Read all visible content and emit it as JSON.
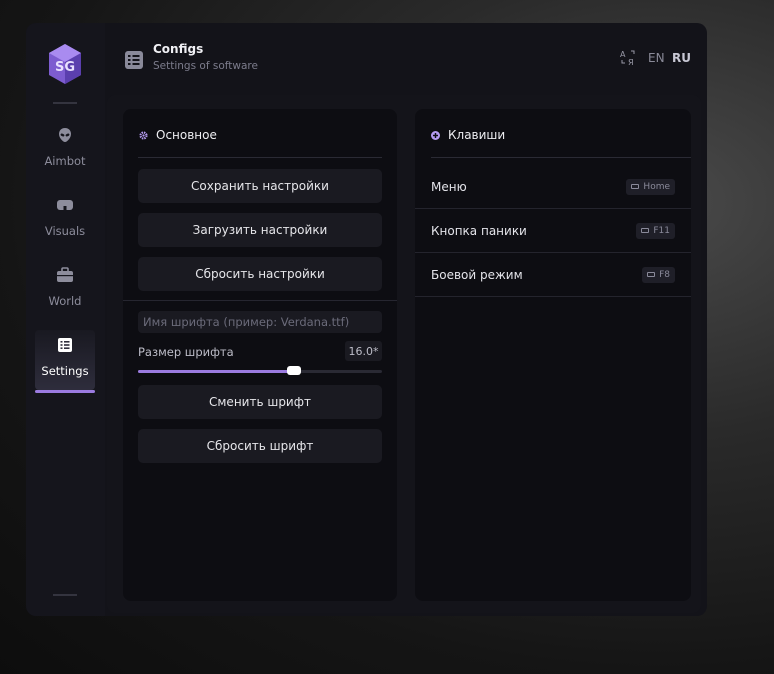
{
  "colors": {
    "accent": "#9b7be0",
    "window_bg": "#131319",
    "panel_bg": "#0d0d12",
    "button_bg": "#1a1a21"
  },
  "header": {
    "icon": "list-icon",
    "title": "Configs",
    "subtitle": "Settings of software"
  },
  "language": {
    "icon": "translate-icon",
    "options": [
      "EN",
      "RU"
    ],
    "selected": "RU"
  },
  "sidebar": {
    "logo": "sg-logo",
    "items": [
      {
        "label": "Aimbot",
        "icon": "alien-icon",
        "active": false
      },
      {
        "label": "Visuals",
        "icon": "vr-goggles-icon",
        "active": false
      },
      {
        "label": "World",
        "icon": "briefcase-icon",
        "active": false
      },
      {
        "label": "Settings",
        "icon": "list-icon",
        "active": true
      }
    ]
  },
  "main_panel": {
    "title": "Основное",
    "icon": "gear-icon",
    "buttons": {
      "save": "Сохранить настройки",
      "load": "Загрузить настройки",
      "reset": "Сбросить настройки"
    },
    "font": {
      "name_placeholder": "Имя шрифта (пример: Verdana.ttf)",
      "size_label": "Размер шрифта",
      "size_value": "16.0*",
      "size_level": 0.64,
      "change_button": "Сменить шрифт",
      "reset_button": "Сбросить шрифт"
    }
  },
  "keys_panel": {
    "title": "Клавиши",
    "icon": "plus-circle-icon",
    "rows": [
      {
        "label": "Меню",
        "key": "Home"
      },
      {
        "label": "Кнопка паники",
        "key": "F11"
      },
      {
        "label": "Боевой режим",
        "key": "F8"
      }
    ]
  }
}
